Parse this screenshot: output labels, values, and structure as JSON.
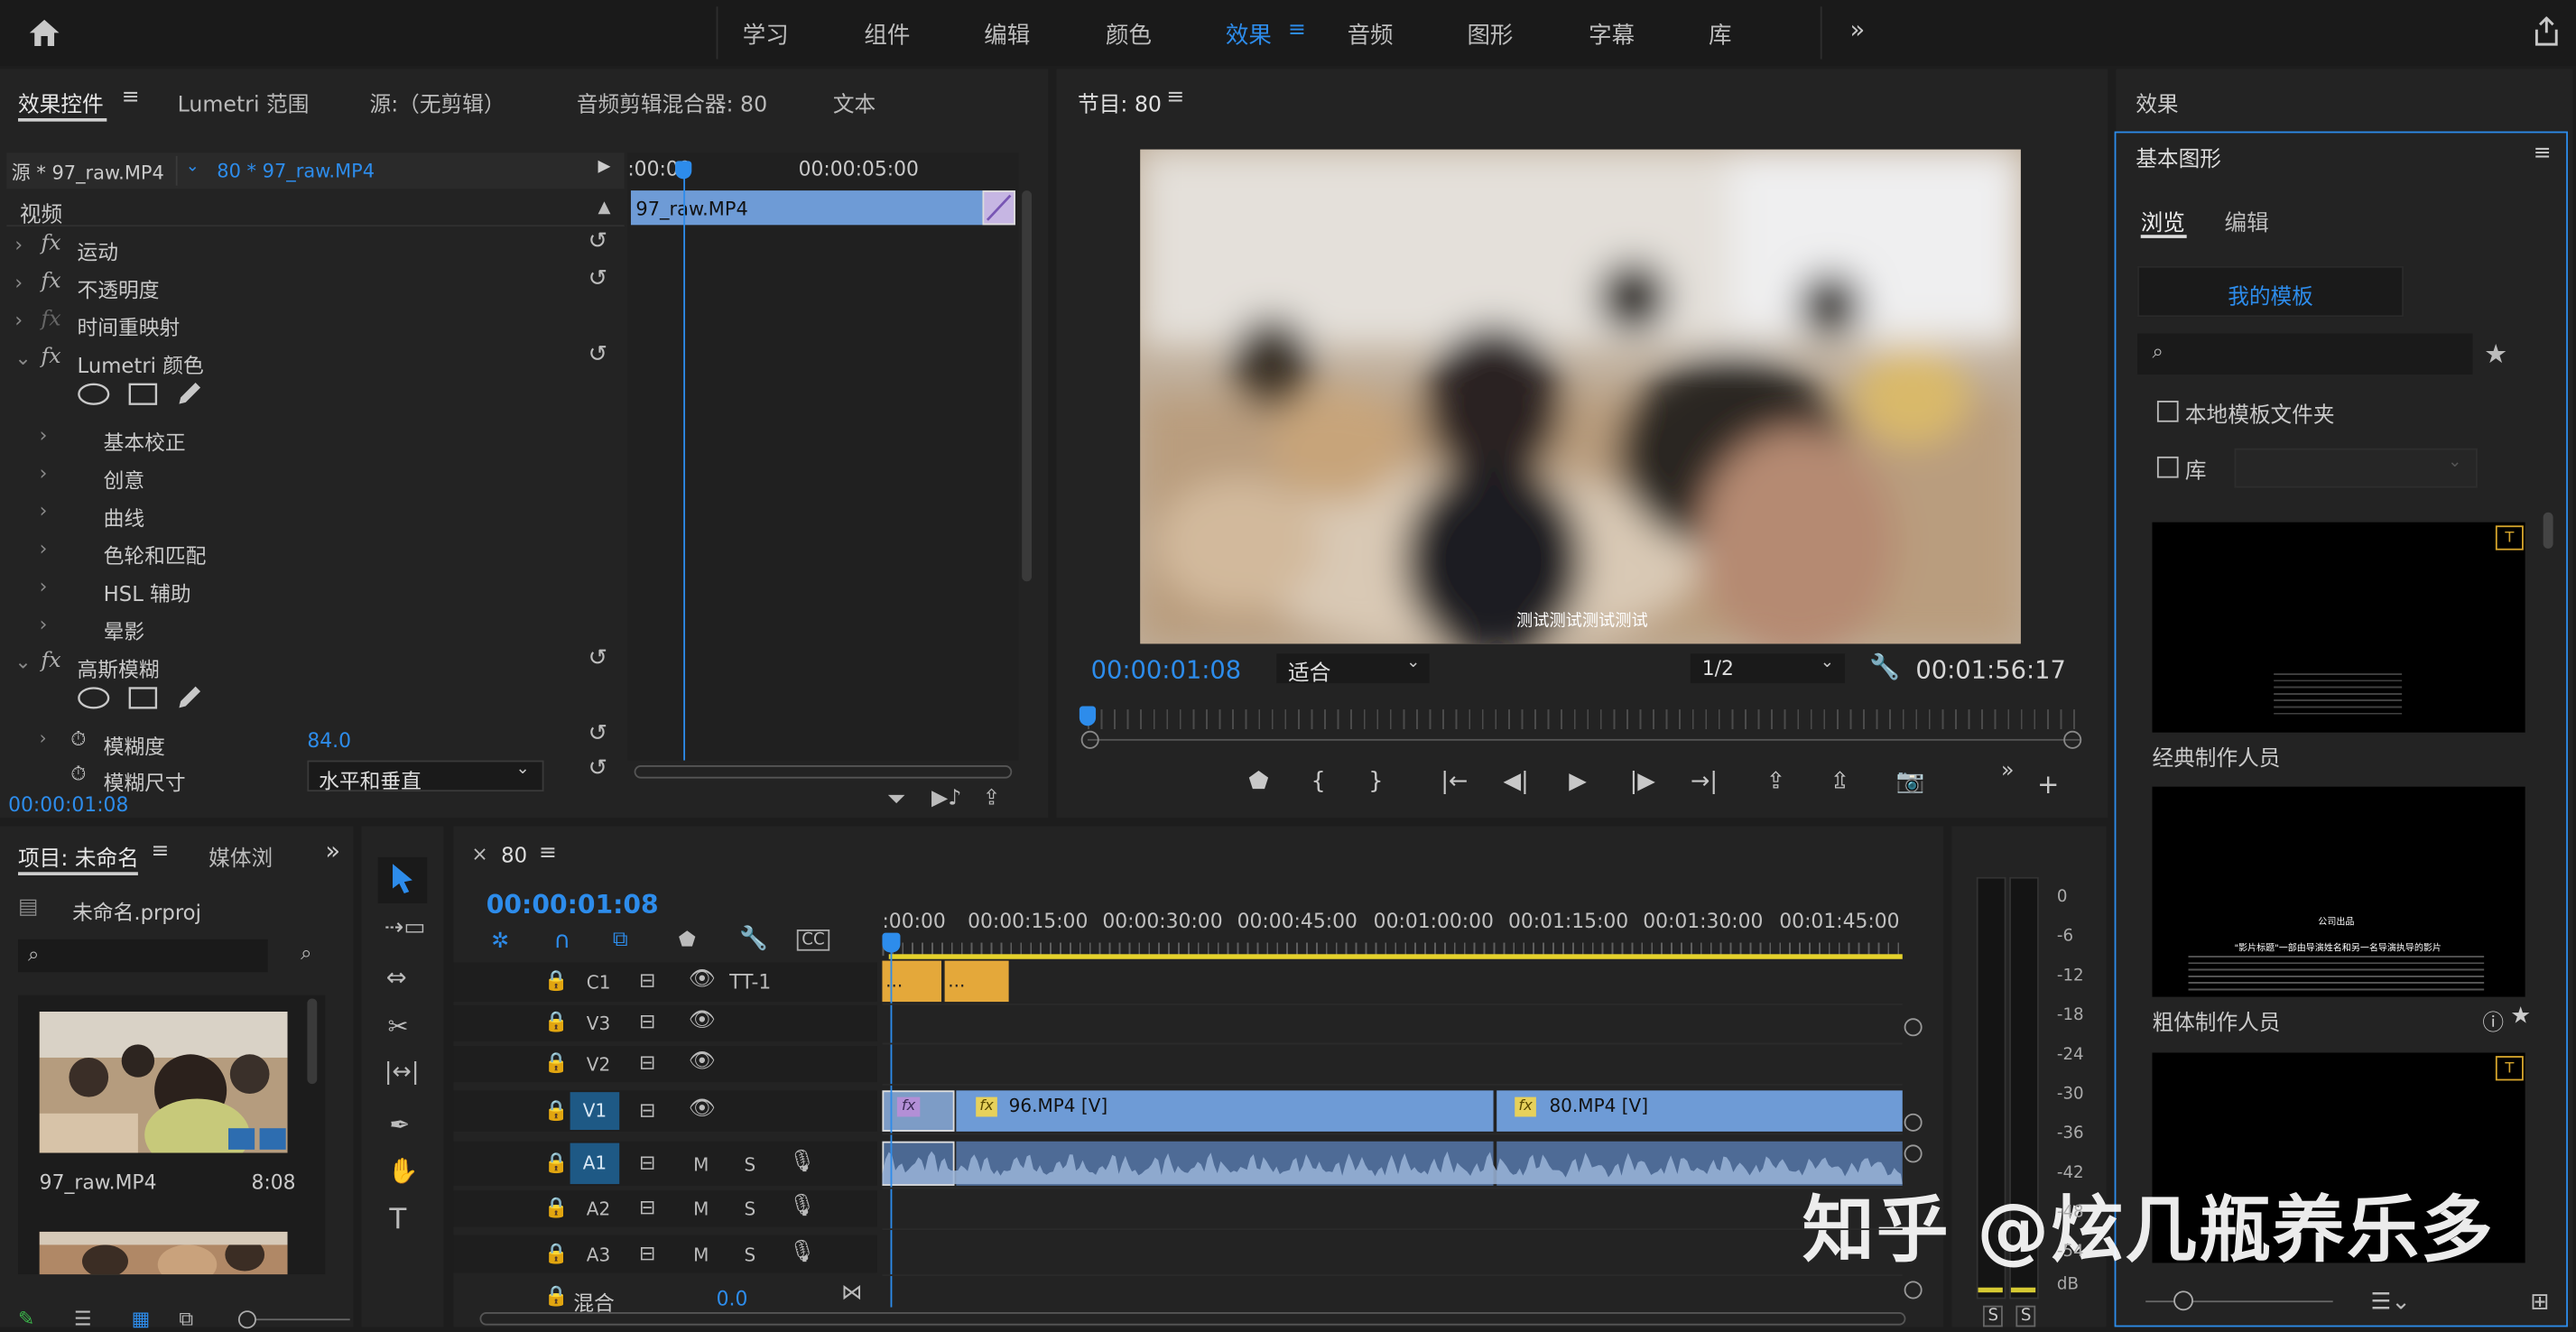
{
  "nav": {
    "items": [
      "学习",
      "组件",
      "编辑",
      "颜色",
      "效果",
      "音频",
      "图形",
      "字幕",
      "库"
    ],
    "active": "效果"
  },
  "effect_controls": {
    "tabs": [
      "效果控件",
      "Lumetri 范围",
      "源:（无剪辑）",
      "音频剪辑混合器: 80",
      "文本"
    ],
    "source_label": "源 * 97_raw.MP4",
    "sequence_clip": "80 * 97_raw.MP4",
    "ruler_start": ":00:00",
    "ruler_mid": "00:00:05:00",
    "clip_name": "97_raw.MP4",
    "section_video": "视频",
    "effects": [
      "运动",
      "不透明度",
      "时间重映射",
      "Lumetri 颜色"
    ],
    "lumetri_sub": [
      "基本校正",
      "创意",
      "曲线",
      "色轮和匹配",
      "HSL 辅助",
      "晕影"
    ],
    "blur_effect": "高斯模糊",
    "blur_param": "模糊度",
    "blur_value": "84.0",
    "blur_dim_param": "模糊尺寸",
    "blur_dim_value": "水平和垂直",
    "timecode": "00:00:01:08"
  },
  "program": {
    "title": "节目: 80",
    "timecode": "00:00:01:08",
    "fit": "适合",
    "resolution": "1/2",
    "duration": "00:01:56:17",
    "subtitle": "测试测试测试测试"
  },
  "effects_panel": {
    "title": "效果",
    "subtitle": "基本图形",
    "tabs": [
      "浏览",
      "编辑"
    ],
    "my_templates": "我的模板",
    "local_folder": "本地模板文件夹",
    "library": "库",
    "templates": [
      "经典制作人员",
      "粗体制作人员"
    ],
    "tpl_tiny": "公司出品",
    "tpl_line1": "\"影片标题\"一部由导演姓名和另一名导演执导的影片"
  },
  "project": {
    "tabs": [
      "项目: 未命名",
      "媒体浏"
    ],
    "file": "未命名.prproj",
    "clip_name": "97_raw.MP4",
    "clip_duration": "8:08"
  },
  "timeline": {
    "sequence": "80",
    "timecode": "00:00:01:08",
    "ruler": [
      ":00:00",
      "00:00:15:00",
      "00:00:30:00",
      "00:00:45:00",
      "00:01:00:00",
      "00:01:15:00",
      "00:01:30:00",
      "00:01:45:00"
    ],
    "tracks": [
      "C1",
      "V3",
      "V2",
      "V1",
      "A1",
      "A2",
      "A3"
    ],
    "caption_track_name": "TT-1",
    "mix_label": "混合",
    "mix_value": "0.0",
    "clips_v1": [
      "96.MP4 [V]",
      "80.MP4 [V]"
    ],
    "track_m": "M",
    "track_s": "S",
    "caption_dots": "..."
  },
  "meter": {
    "scale": [
      "0",
      "-6",
      "-12",
      "-18",
      "-24",
      "-30",
      "-36",
      "-42",
      "-48",
      "-54",
      "dB"
    ],
    "solo": [
      "S",
      "S"
    ]
  },
  "watermark": "知乎 @炫几瓶养乐多",
  "colors": {
    "accent": "#2d8ceb",
    "panel": "#232323",
    "clip": "#6e9bd6",
    "caption": "#e4a83a",
    "playhead": "#2d8ceb"
  }
}
